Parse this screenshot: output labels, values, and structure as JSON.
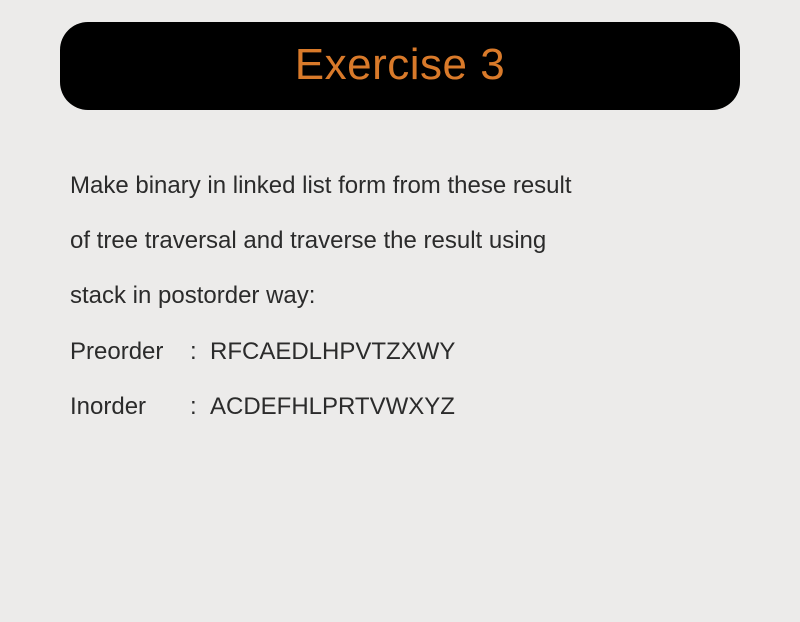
{
  "title": "Exercise 3",
  "instruction_lines": [
    "Make binary in linked list form from these result",
    "of tree traversal and traverse the result using",
    "stack in postorder way:"
  ],
  "traversals": [
    {
      "label": "Preorder",
      "value": "RFCAEDLHPVTZXWY"
    },
    {
      "label": "Inorder",
      "value": "ACDEFHLPRTVWXYZ"
    }
  ]
}
